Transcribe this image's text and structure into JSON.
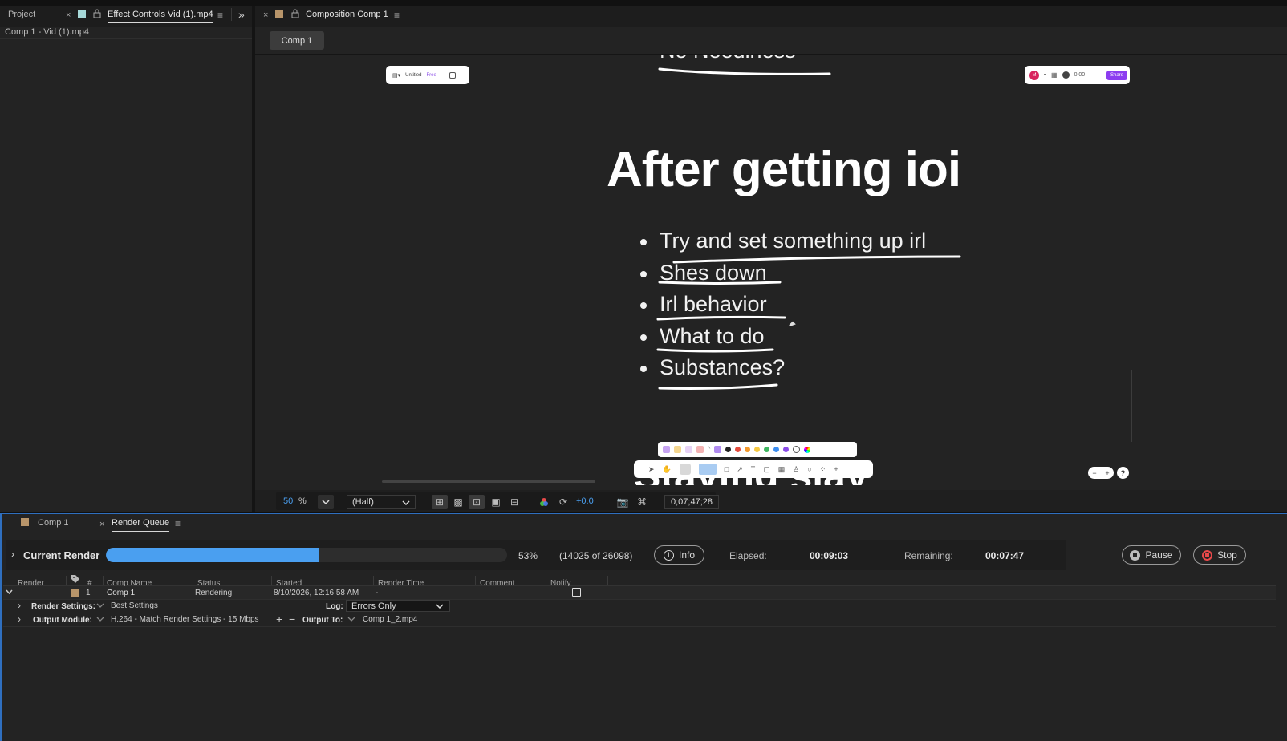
{
  "project_panel": {
    "tab_project": "Project",
    "tab_effect_controls": "Effect Controls Vid (1).mp4",
    "breadcrumb": "Comp 1 - Vid (1).mp4"
  },
  "composition_panel": {
    "tab_title": "Composition Comp 1",
    "comp_button": "Comp 1",
    "slide": {
      "top_partial_text": "No Neediness",
      "title": "After getting ioi",
      "bullets": [
        "Try and set something up irl",
        "Shes down",
        "Irl behavior",
        "What to do",
        "Substances?"
      ],
      "bottom_partial_text": "Staying slay",
      "overlay_left": {
        "doc_name": "Untitled",
        "plan": "Free"
      },
      "overlay_right": {
        "avatar_letter": "M",
        "timer": "0:00",
        "share": "Share"
      }
    },
    "footer": {
      "zoom_value": "50",
      "zoom_unit": "%",
      "resolution": "(Half)",
      "exposure": "+0.0",
      "timecode": "0;07;47;28"
    }
  },
  "render_panel": {
    "tab_comp": "Comp 1",
    "tab_render_queue": "Render Queue",
    "current_render_label": "Current Render",
    "progress": 0.53,
    "percent": "53%",
    "frames": "(14025 of 26098)",
    "info_label": "Info",
    "elapsed_label": "Elapsed:",
    "elapsed_value": "00:09:03",
    "remaining_label": "Remaining:",
    "remaining_value": "00:07:47",
    "pause_label": "Pause",
    "stop_label": "Stop",
    "columns": [
      "Render",
      "#",
      "Comp Name",
      "Status",
      "Started",
      "Render Time",
      "Comment",
      "Notify"
    ],
    "item": {
      "number": "1",
      "comp_name": "Comp 1",
      "status": "Rendering",
      "started": "8/10/2026, 12:16:58 AM",
      "render_time": "-"
    },
    "render_settings_label": "Render Settings:",
    "render_settings_value": "Best Settings",
    "log_label": "Log:",
    "log_value": "Errors Only",
    "output_module_label": "Output Module:",
    "output_module_value": "H.264 - Match Render Settings - 15 Mbps",
    "output_to_label": "Output To:",
    "output_to_value": "Comp 1_2.mp4"
  },
  "colors": {
    "accent_blue": "#4a9ff0",
    "label_tan": "#b8956a",
    "label_aqua": "#a6d8d8",
    "stop_red": "#e8484a"
  }
}
